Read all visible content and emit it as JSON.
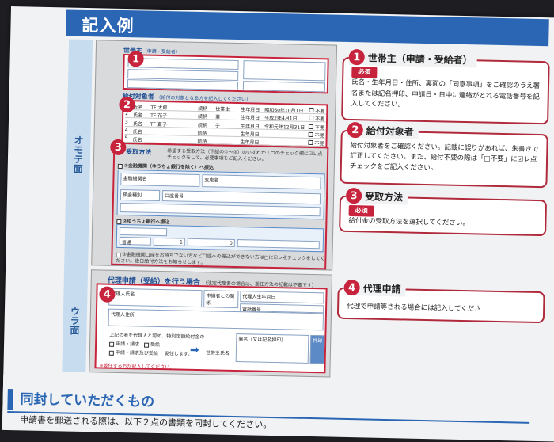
{
  "header": {
    "title": "記入例"
  },
  "side_tabs": {
    "front": "オモテ面",
    "back": "ウラ面"
  },
  "form": {
    "s1": {
      "label": "世帯主",
      "sub": "（申請・受給者）"
    },
    "s2": {
      "label": "給付対象者",
      "note": "（給付の対象となる方を記入してください）",
      "rows": [
        {
          "no": "1",
          "name": "TF 太郎",
          "rel": "世帯主",
          "dob": "昭和60年10月1日"
        },
        {
          "no": "2",
          "name": "TF 花子",
          "rel": "妻",
          "dob": "平成2年4月1日"
        },
        {
          "no": "3",
          "name": "TF 直子",
          "rel": "子",
          "dob": "令和元年12月31日"
        },
        {
          "no": "4",
          "name": "",
          "rel": "",
          "dob": ""
        },
        {
          "no": "5",
          "name": "",
          "rel": "",
          "dob": ""
        }
      ],
      "col_name": "氏名",
      "col_rel": "続柄",
      "col_dob": "生年月日",
      "col_flag": "不要"
    },
    "s3": {
      "label": "受取方法",
      "lead": "希望する受取方法（下記の①〜③）のいずれか１つのチェック欄に☑レ点チェックをして、必要事項をご記入ください。",
      "opt1": "①金融機関（ゆうちょ銀行を除く）へ振込",
      "opt2": "②ゆうちょ銀行へ振込",
      "opt3": "③金融機関口座をお持ちでない方など口座への振込ができない方は□に☑レ点チェックをしてください。後日給付方法をお知らせします。",
      "bank": "金融機関名",
      "branch": "支店名",
      "account": "口座番号",
      "deposit": "預金種別",
      "type": "普通",
      "seven": "1",
      "digits": "0"
    },
    "s4": {
      "label": "代理申請（受給）を行う場合",
      "note": "（法定代理者の場合は、委任方法の記載は不要です）",
      "agent_name": "代理人氏名",
      "agent_addr": "代理人住所",
      "rel": "申請者との関係",
      "dob": "代理人生年月日",
      "tel": "電話番号",
      "consent": "上記の者を代理人と認め、特別定額給付金の",
      "o1": "申請・請求",
      "o2": "受給",
      "o3": "申請・請求及び受給",
      "delegate": "委任します。",
      "applicant": "世帯主氏名",
      "sign": "署名（又は記名押印）",
      "seal": "押印",
      "footer": "※委任する方が記入してください。"
    }
  },
  "cards": [
    {
      "num": "1",
      "title": "世帯主（申請・受給者）",
      "badge": "必須",
      "text": "氏名・生年月日・住所、裏面の「同意事項」をご確認のうえ署名または記名押印、申請日・日中に連絡がとれる電話番号を記入してください。"
    },
    {
      "num": "2",
      "title": "給付対象者",
      "text": "給付対象者をご確認ください。記載に誤りがあれば、朱書きで訂正してください。また、給付不要の際は「□不要」に☑レ点チェックをご記入ください。"
    },
    {
      "num": "3",
      "title": "受取方法",
      "badge": "必須",
      "text": "給付金の受取方法を選択してください。"
    },
    {
      "num": "4",
      "title": "代理申請",
      "text": "代理で申請等される場合には記入してくださ"
    }
  ],
  "bottom": {
    "title": "同封していただくもの",
    "sub": "申請書を郵送される際は、以下２点の書類を同封してください。"
  }
}
